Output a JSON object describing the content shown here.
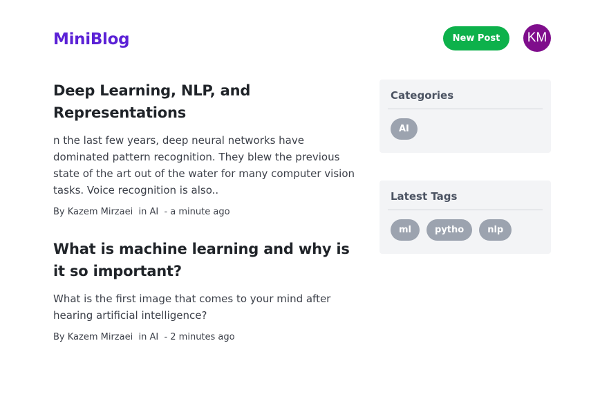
{
  "header": {
    "brand": "MiniBlog",
    "new_post_label": "New Post",
    "avatar_initials": "KM"
  },
  "posts": [
    {
      "title": "Deep Learning, NLP, and Representations",
      "excerpt": "n the last few years, deep neural networks have dominated pattern recognition. They blew the previous state of the art out of the water for many computer vision tasks. Voice recognition is also..",
      "author_prefix": "By ",
      "author": "Kazem Mirzaei",
      "category_prefix": "  in ",
      "category": "AI",
      "time": "  - a minute ago"
    },
    {
      "title": "What is machine learning and why is it so important?",
      "excerpt": "What is the first image that comes to your mind after hearing artificial intelligence?",
      "author_prefix": "By ",
      "author": "Kazem Mirzaei",
      "category_prefix": "  in ",
      "category": "AI",
      "time": "  - 2 minutes ago"
    }
  ],
  "sidebar": {
    "categories": {
      "title": "Categories",
      "items": [
        "AI"
      ]
    },
    "tags": {
      "title": "Latest Tags",
      "items": [
        "ml",
        "pytho",
        "nlp"
      ]
    }
  },
  "colors": {
    "brand": "#5b21d6",
    "new_post_bg": "#0db14b",
    "avatar_bg": "#7f0e8c",
    "chip_bg": "#9ca3af",
    "card_bg": "#f3f4f6"
  }
}
